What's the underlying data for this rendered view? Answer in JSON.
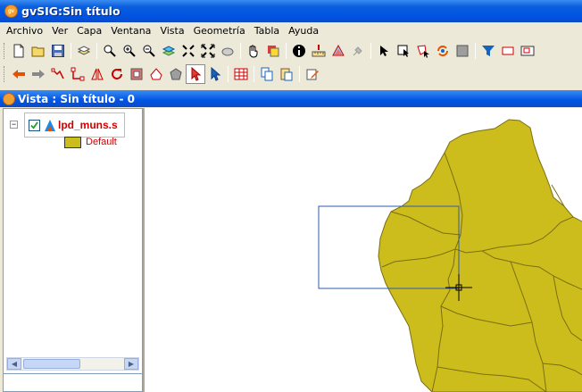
{
  "window": {
    "title": "gvSIG:Sin título"
  },
  "menu": [
    "Archivo",
    "Ver",
    "Capa",
    "Ventana",
    "Vista",
    "Geometría",
    "Tabla",
    "Ayuda"
  ],
  "toolbar1": [
    "new-document-icon",
    "open-folder-icon",
    "save-disk-icon",
    "layers-add-icon",
    "zoom-in-icon",
    "zoom-plus-icon",
    "zoom-minus-icon",
    "zoom-layer-icon",
    "zoom-full-icon",
    "zoom-extents-icon",
    "zoom-select-icon",
    "pan-hand-icon",
    "raster-icon",
    "info-icon",
    "measure-distance-icon",
    "measure-area-icon",
    "hyperlink-icon",
    "select-arrow-icon",
    "select-rect-icon",
    "select-polygon-icon",
    "select-by-layer-icon",
    "clear-selection-icon",
    "filter-icon",
    "rectangle-icon",
    "locator-icon"
  ],
  "toolbar2": [
    "back-arrow-icon",
    "forward-arrow-icon",
    "edge-icon",
    "vertex-icon",
    "mirror-icon",
    "rotate-icon",
    "scale-icon",
    "polygon-edit-icon",
    "polygon-gray-icon",
    "pointer-red-icon",
    "pointer-blue-icon",
    "table-icon",
    "copy-icon",
    "paste-icon",
    "edit-properties-icon"
  ],
  "view": {
    "title": "Vista : Sin título - 0",
    "toc": {
      "layer_name": "lpd_muns.s",
      "checked": true,
      "legend_label": "Default",
      "legend_color": "#cdbd1c"
    }
  },
  "colors": {
    "map_fill": "#cdbd1c",
    "map_stroke": "#7a6e10",
    "selection_rect": "#2d5bb5"
  }
}
